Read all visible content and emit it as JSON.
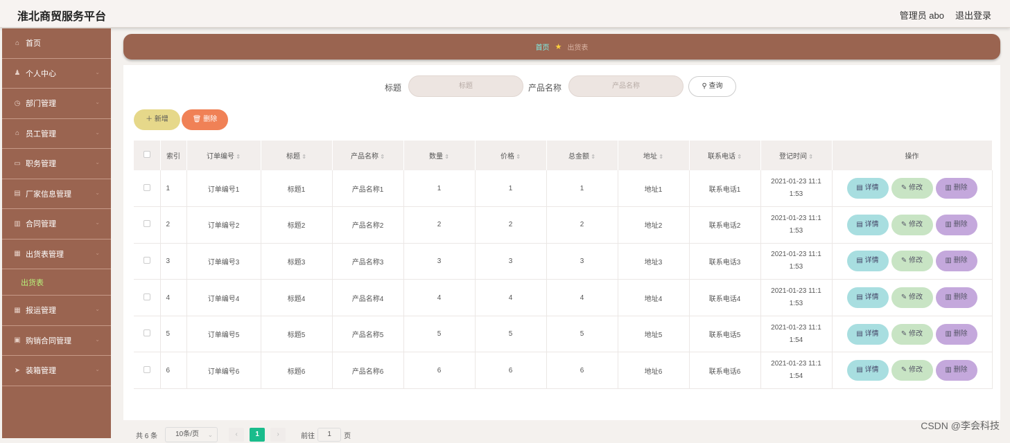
{
  "header": {
    "brand": "淮北商贸服务平台",
    "user": "管理员 abo",
    "logout": "退出登录"
  },
  "sidebar": {
    "items": [
      {
        "icon": "home-icon",
        "glyph": "⌂",
        "label": "首页",
        "arrow": false
      },
      {
        "icon": "person-icon",
        "glyph": "♟",
        "label": "个人中心",
        "arrow": true
      },
      {
        "icon": "clock-icon",
        "glyph": "◷",
        "label": "部门管理",
        "arrow": true
      },
      {
        "icon": "bank-icon",
        "glyph": "⌂",
        "label": "员工管理",
        "arrow": true
      },
      {
        "icon": "card-icon",
        "glyph": "▭",
        "label": "职务管理",
        "arrow": true
      },
      {
        "icon": "file-icon",
        "glyph": "▤",
        "label": "厂家信息管理",
        "arrow": true
      },
      {
        "icon": "chart-icon",
        "glyph": "▥",
        "label": "合同管理",
        "arrow": true
      },
      {
        "icon": "grid-icon",
        "glyph": "▦",
        "label": "出货表管理",
        "arrow": true
      }
    ],
    "sub_item": "出货表",
    "items2": [
      {
        "icon": "grid-icon",
        "glyph": "▦",
        "label": "报运管理",
        "arrow": true
      },
      {
        "icon": "cart-icon",
        "glyph": "▣",
        "label": "购销合同管理",
        "arrow": true
      },
      {
        "icon": "send-icon",
        "glyph": "➤",
        "label": "装箱管理",
        "arrow": true
      }
    ]
  },
  "breadcrumb": {
    "home": "首页",
    "current": "出货表"
  },
  "search": {
    "title_label": "标题",
    "title_placeholder": "标题",
    "product_label": "产品名称",
    "product_placeholder": "产品名称",
    "query_button": "查询"
  },
  "actions": {
    "add": "新增",
    "delete": "删除"
  },
  "table": {
    "headers": [
      "索引",
      "订单编号",
      "标题",
      "产品名称",
      "数量",
      "价格",
      "总金额",
      "地址",
      "联系电话",
      "登记时间",
      "操作"
    ],
    "rows": [
      {
        "idx": "1",
        "order": "订单编号1",
        "title": "标题1",
        "product": "产品名称1",
        "qty": "1",
        "price": "1",
        "total": "1",
        "addr": "地址1",
        "phone": "联系电话1",
        "time1": "2021-01-23 11:1",
        "time2": "1:53"
      },
      {
        "idx": "2",
        "order": "订单编号2",
        "title": "标题2",
        "product": "产品名称2",
        "qty": "2",
        "price": "2",
        "total": "2",
        "addr": "地址2",
        "phone": "联系电话2",
        "time1": "2021-01-23 11:1",
        "time2": "1:53"
      },
      {
        "idx": "3",
        "order": "订单编号3",
        "title": "标题3",
        "product": "产品名称3",
        "qty": "3",
        "price": "3",
        "total": "3",
        "addr": "地址3",
        "phone": "联系电话3",
        "time1": "2021-01-23 11:1",
        "time2": "1:53"
      },
      {
        "idx": "4",
        "order": "订单编号4",
        "title": "标题4",
        "product": "产品名称4",
        "qty": "4",
        "price": "4",
        "total": "4",
        "addr": "地址4",
        "phone": "联系电话4",
        "time1": "2021-01-23 11:1",
        "time2": "1:53"
      },
      {
        "idx": "5",
        "order": "订单编号5",
        "title": "标题5",
        "product": "产品名称5",
        "qty": "5",
        "price": "5",
        "total": "5",
        "addr": "地址5",
        "phone": "联系电话5",
        "time1": "2021-01-23 11:1",
        "time2": "1:54"
      },
      {
        "idx": "6",
        "order": "订单编号6",
        "title": "标题6",
        "product": "产品名称6",
        "qty": "6",
        "price": "6",
        "total": "6",
        "addr": "地址6",
        "phone": "联系电话6",
        "time1": "2021-01-23 11:1",
        "time2": "1:54"
      }
    ],
    "ops": {
      "detail": "详情",
      "edit": "修改",
      "delete": "删除"
    }
  },
  "pager": {
    "total": "共 6 条",
    "page_size": "10条/页",
    "current_page": "1",
    "goto_label": "前往",
    "goto_value": "1",
    "page_suffix": "页",
    "prev": "‹",
    "next": "›"
  },
  "watermark": "CSDN @李会科技",
  "colors": {
    "sidebar": "#9a6450",
    "accent_green": "#1abc8c",
    "delete": "#f08156",
    "add": "#e6d88a"
  }
}
